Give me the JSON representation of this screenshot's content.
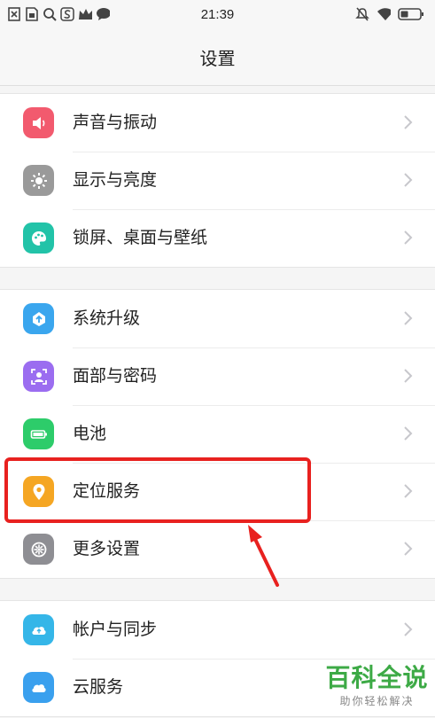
{
  "status_bar": {
    "time": "21:39",
    "left_icons": [
      "sim-x-icon",
      "sim-card-icon",
      "search-icon",
      "s-app-icon",
      "crown-icon",
      "chat-bubble-icon"
    ],
    "right_icons": [
      "mute-icon",
      "wifi-icon",
      "battery-icon"
    ]
  },
  "header": {
    "title": "设置"
  },
  "groups": [
    {
      "items": [
        {
          "label": "声音与振动",
          "icon": "speaker-icon",
          "color": "#f25a6e"
        },
        {
          "label": "显示与亮度",
          "icon": "sun-icon",
          "color": "#9a9a9a"
        },
        {
          "label": "锁屏、桌面与壁纸",
          "icon": "palette-icon",
          "color": "#22c3a8"
        }
      ]
    },
    {
      "items": [
        {
          "label": "系统升级",
          "icon": "upgrade-icon",
          "color": "#3aa6ee"
        },
        {
          "label": "面部与密码",
          "icon": "face-id-icon",
          "color": "#9b6df0"
        },
        {
          "label": "电池",
          "icon": "battery-icon",
          "color": "#2dcc6a"
        },
        {
          "label": "定位服务",
          "icon": "location-pin-icon",
          "color": "#f5a623"
        },
        {
          "label": "更多设置",
          "icon": "gear-icon",
          "color": "#8e8e93"
        }
      ]
    },
    {
      "items": [
        {
          "label": "帐户与同步",
          "icon": "cloud-sync-icon",
          "color": "#35b6e8"
        },
        {
          "label": "云服务",
          "icon": "cloud-icon",
          "color": "#3aa0ee"
        }
      ]
    }
  ],
  "annotation": {
    "highlight_color": "#e8211f",
    "highlighted_item": "定位服务"
  },
  "watermark": {
    "main": "百科全说",
    "sub": "助你轻松解决"
  }
}
